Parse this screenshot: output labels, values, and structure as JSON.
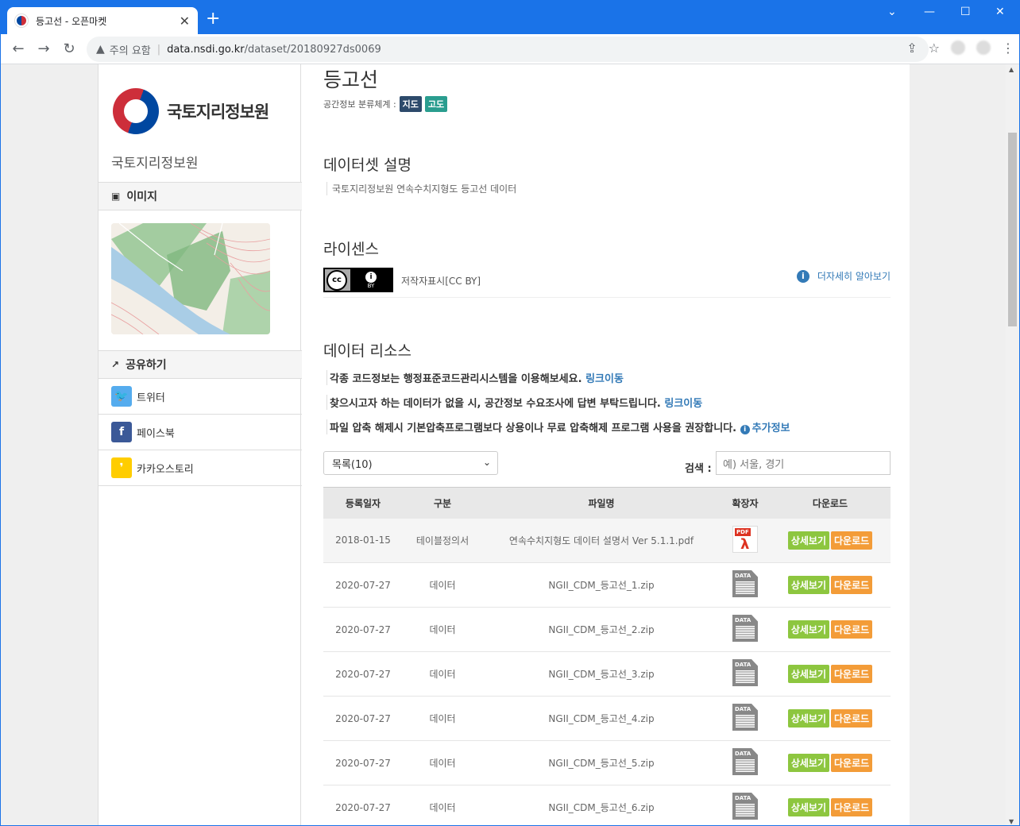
{
  "browser": {
    "tab_title": "등고선 - 오픈마켓",
    "tab_close": "✕",
    "new_tab": "+",
    "security_label": "주의 요함",
    "url_domain": "data.nsdi.go.kr",
    "url_path": "/dataset/20180927ds0069"
  },
  "sidebar": {
    "logo_text": "국토지리정보원",
    "org_name": "국토지리정보원",
    "image_section": "이미지",
    "share_section": "공유하기",
    "share_items": [
      {
        "label": "트위터",
        "color": "#55acee",
        "icon": "twitter-icon"
      },
      {
        "label": "페이스북",
        "color": "#3b5998",
        "icon": "facebook-icon"
      },
      {
        "label": "카카오스토리",
        "color": "#ffcd00",
        "icon": "kakaostory-icon"
      }
    ]
  },
  "main": {
    "title": "등고선",
    "taxonomy_label": "공간정보 분류체계 :",
    "badges": [
      {
        "label": "지도",
        "color": "#2d4a6b"
      },
      {
        "label": "고도",
        "color": "#2a9d8f"
      }
    ],
    "description_heading": "데이터셋 설명",
    "description": "국토지리정보원 연속수치지형도 등고선 데이터",
    "license_heading": "라이센스",
    "license_text": "저작자표시[CC BY]",
    "license_more": "더자세히 알아보기",
    "resources_heading": "데이터 리소스",
    "notices": [
      {
        "text": "각종 코드정보는 행정표준코드관리시스템을 이용해보세요.",
        "link": "링크이동"
      },
      {
        "text": "찾으시고자 하는 데이터가 없을 시, 공간정보 수요조사에 답변 부탁드립니다.",
        "link": "링크이동"
      },
      {
        "text": "파일 압축 해제시 기본압축프로그램보다 상용이나 무료 압축해제 프로그램 사용을 권장합니다.",
        "link": "추가정보"
      }
    ],
    "list_select": "목록(10)",
    "search_label": "검색 :",
    "search_placeholder": "예) 서울, 경기",
    "table": {
      "headers": [
        "등록일자",
        "구분",
        "파일명",
        "확장자",
        "다운로드"
      ],
      "detail_label": "상세보기",
      "download_label": "다운로드",
      "rows": [
        {
          "date": "2018-01-15",
          "type": "테이블정의서",
          "file": "연속수치지형도 데이터 설명서 Ver 5.1.1.pdf",
          "ext": "pdf"
        },
        {
          "date": "2020-07-27",
          "type": "데이터",
          "file": "NGII_CDM_등고선_1.zip",
          "ext": "data"
        },
        {
          "date": "2020-07-27",
          "type": "데이터",
          "file": "NGII_CDM_등고선_2.zip",
          "ext": "data"
        },
        {
          "date": "2020-07-27",
          "type": "데이터",
          "file": "NGII_CDM_등고선_3.zip",
          "ext": "data"
        },
        {
          "date": "2020-07-27",
          "type": "데이터",
          "file": "NGII_CDM_등고선_4.zip",
          "ext": "data"
        },
        {
          "date": "2020-07-27",
          "type": "데이터",
          "file": "NGII_CDM_등고선_5.zip",
          "ext": "data"
        },
        {
          "date": "2020-07-27",
          "type": "데이터",
          "file": "NGII_CDM_등고선_6.zip",
          "ext": "data"
        }
      ]
    }
  }
}
